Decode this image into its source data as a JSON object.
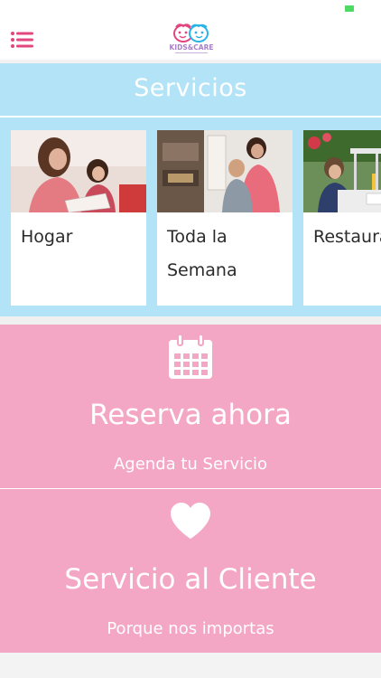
{
  "app": {
    "logo_text": "KIDS&CARE"
  },
  "services": {
    "title": "Servicios",
    "cards": [
      {
        "label": "Hogar"
      },
      {
        "label": "Toda la Semana"
      },
      {
        "label": "Restaura"
      }
    ]
  },
  "reserve": {
    "title": "Reserva ahora",
    "subtitle": "Agenda tu Servicio",
    "icon": "calendar-icon"
  },
  "customer_service": {
    "title": "Servicio al Cliente",
    "subtitle": "Porque nos importas",
    "icon": "heart-icon"
  },
  "colors": {
    "accent": "#e2467f",
    "services_bg": "#b3e3f6",
    "panel_bg": "#f4a6c5"
  }
}
